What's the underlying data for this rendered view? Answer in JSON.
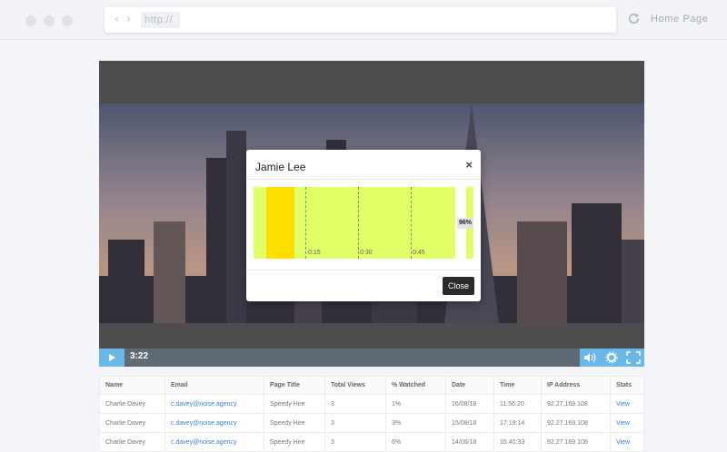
{
  "browser": {
    "url_text": "http://",
    "back_icon": "chevron-left-icon",
    "forward_icon": "chevron-right-icon",
    "reload_icon": "reload-icon",
    "home_label": "Home Page"
  },
  "player": {
    "time": "3:22",
    "progress_percent": 0,
    "play_icon": "play-icon",
    "volume_icon": "volume-icon",
    "settings_icon": "gear-icon",
    "fullscreen_icon": "fullscreen-icon"
  },
  "modal": {
    "title": "Jamie Lee",
    "close_x": "×",
    "ticks": [
      "0:15",
      "0:30",
      "0:45"
    ],
    "percent": "96%",
    "close_label": "Close",
    "colors": {
      "watched": "#e1ff66",
      "hotspot": "#ffdf00"
    }
  },
  "table": {
    "headers": [
      "Name",
      "Email",
      "Page Title",
      "Total Views",
      "% Watched",
      "Date",
      "Time",
      "IP Address",
      "Stats"
    ],
    "rows": [
      [
        "Charlie Davey",
        "c.davey@noise.agency",
        "Speedy Hire",
        "3",
        "1%",
        "16/08/18",
        "11:56:20",
        "92.27.169.108",
        "View"
      ],
      [
        "Charlie Davey",
        "c.davey@noise.agency",
        "Speedy Hire",
        "3",
        "3%",
        "15/08/18",
        "17:19:14",
        "92.27.169.108",
        "View"
      ],
      [
        "Charlie Davey",
        "c.davey@noise.agency",
        "Speedy Hire",
        "3",
        "6%",
        "14/08/18",
        "15:40:33",
        "92.27.169.108",
        "View"
      ]
    ]
  }
}
